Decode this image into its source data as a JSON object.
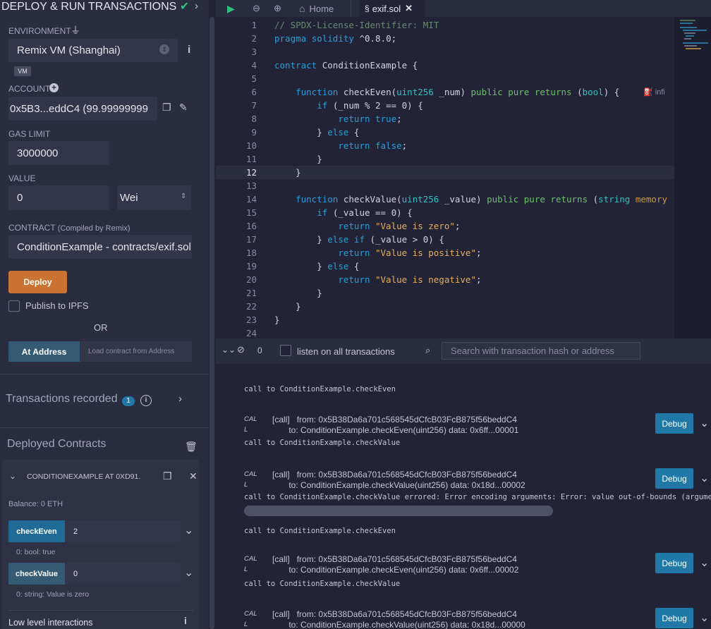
{
  "panel": {
    "title": "DEPLOY & RUN TRANSACTIONS",
    "environment_label": "ENVIRONMENT",
    "environment_value": "Remix VM (Shanghai)",
    "vm_badge": "VM",
    "account_label": "ACCOUNT",
    "account_value": "0x5B3...eddC4 (99.99999999",
    "gas_label": "GAS LIMIT",
    "gas_value": "3000000",
    "value_label": "VALUE",
    "value_amount": "0",
    "value_unit": "Wei",
    "contract_label": "CONTRACT",
    "contract_sub": "(Compiled by Remix)",
    "contract_value": "ConditionExample - contracts/exif.sol",
    "deploy_label": "Deploy",
    "ipfs_label": "Publish to IPFS",
    "or_label": "OR",
    "at_address_label": "At Address",
    "at_address_placeholder": "Load contract from Address",
    "tx_recorded_label": "Transactions recorded",
    "tx_recorded_count": "1",
    "deployed_label": "Deployed Contracts",
    "instance_label": "CONDITIONEXAMPLE AT 0XD91.",
    "balance_label": "Balance: 0 ETH",
    "fn1_label": "checkEven",
    "fn1_input": "2",
    "fn1_result": "0: bool: true",
    "fn2_label": "checkValue",
    "fn2_input": "0",
    "fn2_result": "0: string: Value is zero",
    "low_level_label": "Low level interactions"
  },
  "topbar": {
    "home_label": "Home",
    "file_label": "exif.sol"
  },
  "editor": {
    "line_numbers": [
      "1",
      "2",
      "3",
      "4",
      "5",
      "6",
      "7",
      "8",
      "9",
      "10",
      "11",
      "12",
      "13",
      "14",
      "15",
      "16",
      "17",
      "18",
      "19",
      "20",
      "21",
      "22",
      "23",
      "24"
    ],
    "infer_hint": "infi"
  },
  "terminal": {
    "count": "0",
    "listen_label": "listen on all transactions",
    "search_placeholder": "Search with transaction hash or address",
    "entries": [
      {
        "header": "call to ConditionExample.checkEven"
      },
      {
        "cal": "CAL",
        "l": "L",
        "call": "[call]",
        "from_label": "from:",
        "from": "0x5B38Da6a701c568545dCfcB03FcB875f56beddC4",
        "to_label": "to:",
        "to": "ConditionExample.checkEven(uint256)",
        "data_label": "data:",
        "data": "0x6ff...00001",
        "debug": "Debug"
      },
      {
        "header": "call to ConditionExample.checkValue"
      },
      {
        "cal": "CAL",
        "l": "L",
        "call": "[call]",
        "from_label": "from:",
        "from": "0x5B38Da6a701c568545dCfcB03FcB875f56beddC4",
        "to_label": "to:",
        "to": "ConditionExample.checkValue(uint256)",
        "data_label": "data:",
        "data": "0x18d...00002",
        "debug": "Debug"
      },
      {
        "header": "call to ConditionExample.checkValue errored: Error encoding arguments: Error: value out-of-bounds (argument=nul"
      },
      {
        "header": "call to ConditionExample.checkEven"
      },
      {
        "cal": "CAL",
        "l": "L",
        "call": "[call]",
        "from_label": "from:",
        "from": "0x5B38Da6a701c568545dCfcB03FcB875f56beddC4",
        "to_label": "to:",
        "to": "ConditionExample.checkEven(uint256)",
        "data_label": "data:",
        "data": "0x6ff...00002",
        "debug": "Debug"
      },
      {
        "header": "call to ConditionExample.checkValue"
      },
      {
        "cal": "CAL",
        "l": "L",
        "call": "[call]",
        "from_label": "from:",
        "from": "0x5B38Da6a701c568545dCfcB03FcB875f56beddC4",
        "to_label": "to:",
        "to": "ConditionExample.checkValue(uint256)",
        "data_label": "data:",
        "data": "0x18d...00000",
        "debug": "Debug"
      }
    ]
  },
  "colors": {
    "accent": "#ca7433",
    "debug": "#1f78a6",
    "success": "#2ec27e"
  },
  "icons": [
    "plug-icon",
    "chevron-updown-icon",
    "info-icon",
    "plus-circle-icon",
    "copy-icon",
    "edit-icon",
    "play-icon",
    "zoom-out-icon",
    "zoom-in-icon",
    "home-icon",
    "solidity-icon",
    "close-icon",
    "double-chevron-down-icon",
    "ban-icon",
    "search-icon",
    "chevron-right-icon",
    "trash-icon",
    "chevron-down-icon",
    "check-icon"
  ]
}
